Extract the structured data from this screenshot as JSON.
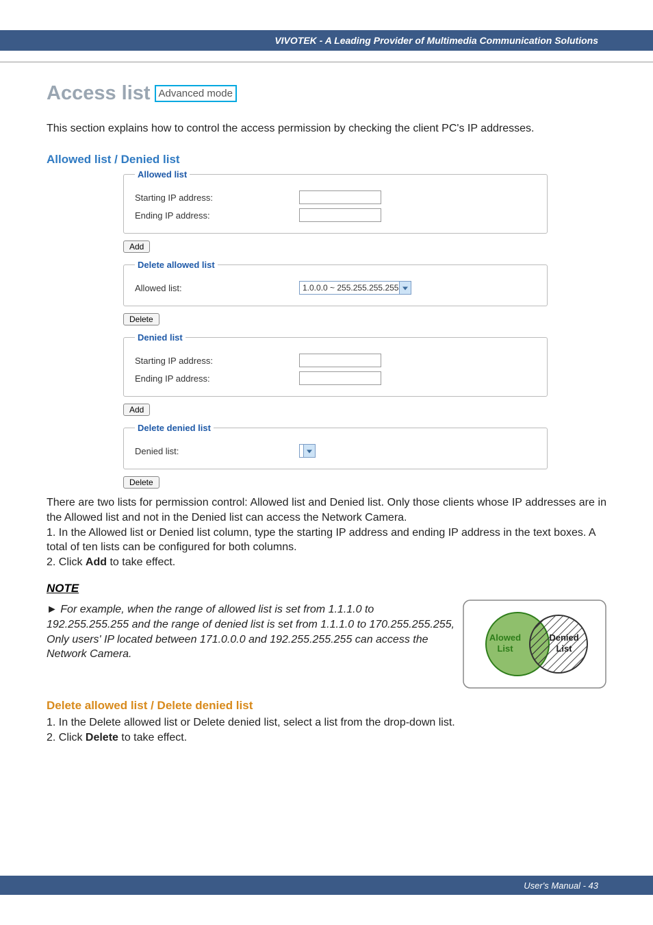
{
  "header": {
    "brand": "VIVOTEK - A Leading Provider of Multimedia Communication Solutions"
  },
  "title": "Access list",
  "adv_mode": "Advanced mode",
  "intro": "This section explains how to control the access permission by checking the client PC's IP addresses.",
  "sections": {
    "allowed_denied_head": "Allowed list / Denied list",
    "delete_head": "Delete allowed list / Delete denied list"
  },
  "ui": {
    "allowed": {
      "legend": "Allowed list",
      "start_label": "Starting IP address:",
      "end_label": "Ending IP address:",
      "start_value": "",
      "end_value": ""
    },
    "add_btn": "Add",
    "del_allowed": {
      "legend": "Delete allowed list",
      "label": "Allowed list:",
      "selected": "1.0.0.0 ~ 255.255.255.255"
    },
    "delete_btn": "Delete",
    "denied": {
      "legend": "Denied list",
      "start_label": "Starting IP address:",
      "end_label": "Ending IP address:",
      "start_value": "",
      "end_value": ""
    },
    "del_denied": {
      "legend": "Delete denied list",
      "label": "Denied list:",
      "selected": ""
    }
  },
  "body": {
    "p1": "There are two lists for permission control: Allowed list and Denied list. Only those clients whose IP addresses are in the Allowed list and not in the Denied list can access the Network Camera.",
    "l1": "1. In the Allowed list or Denied list column, type the starting IP address and ending IP address in the text boxes. A total of ten lists can be configured for both columns.",
    "l2a": "2. Click ",
    "l2b": "Add",
    "l2c": " to take effect.",
    "note_head": "NOTE",
    "note": "► For example, when the range of allowed list is set from 1.1.1.0 to 192.255.255.255 and the range of denied list is set from 1.1.1.0 to 170.255.255.255, Only users' IP located between 171.0.0.0 and 192.255.255.255 can access the Network Camera.",
    "dl1": "1. In the Delete allowed list or Delete denied list, select a list from the drop-down list.",
    "dl2a": "2. Click ",
    "dl2b": "Delete",
    "dl2c": " to take effect."
  },
  "venn": {
    "allowed": "Alowed List",
    "denied": "Denied List"
  },
  "footer": "User's Manual - 43"
}
